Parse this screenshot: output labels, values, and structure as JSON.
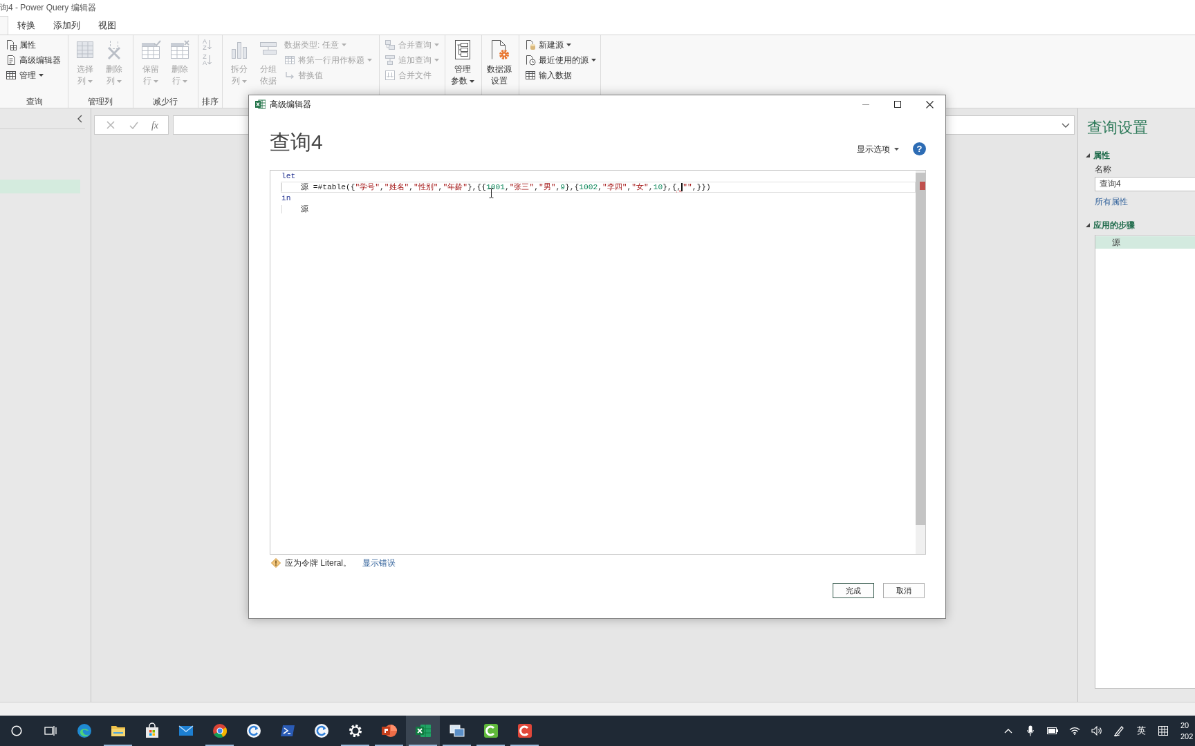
{
  "window": {
    "title": "询4 - Power Query 编辑器"
  },
  "ribbon": {
    "tabs": [
      {
        "label": "转换",
        "selected": false
      },
      {
        "label": "添加列",
        "selected": false
      },
      {
        "label": "视图",
        "selected": false
      }
    ],
    "groups": [
      {
        "label": "查询",
        "items": [
          {
            "kind": "small",
            "label": "属性",
            "disabled": false,
            "dropdown": false
          },
          {
            "kind": "small",
            "label": "高级编辑器",
            "disabled": false,
            "dropdown": false
          },
          {
            "kind": "small",
            "label": "管理",
            "disabled": false,
            "dropdown": true
          }
        ]
      },
      {
        "label": "管理列",
        "items": [
          {
            "kind": "large",
            "lines": [
              "选择",
              "列"
            ],
            "disabled": true,
            "dropdown": true
          },
          {
            "kind": "large",
            "lines": [
              "删除",
              "列"
            ],
            "disabled": true,
            "dropdown": true
          }
        ]
      },
      {
        "label": "减少行",
        "items": [
          {
            "kind": "large",
            "lines": [
              "保留",
              "行"
            ],
            "disabled": true,
            "dropdown": true
          },
          {
            "kind": "large",
            "lines": [
              "删除",
              "行"
            ],
            "disabled": true,
            "dropdown": true
          }
        ]
      },
      {
        "label": "排序",
        "items": [
          {
            "kind": "sort",
            "letters": [
              "A",
              "Z"
            ],
            "disabled": true
          },
          {
            "kind": "sort",
            "letters": [
              "Z",
              "A"
            ],
            "disabled": true
          }
        ]
      },
      {
        "items": [
          {
            "kind": "large",
            "lines": [
              "拆分",
              "列"
            ],
            "disabled": true,
            "dropdown": true
          },
          {
            "kind": "large",
            "lines": [
              "分组",
              "依据"
            ],
            "disabled": true,
            "dropdown": false
          },
          {
            "kind": "small",
            "label": "数据类型: 任意",
            "disabled": true,
            "dropdown": true
          },
          {
            "kind": "small",
            "label": "将第一行用作标题",
            "disabled": true,
            "dropdown": true
          },
          {
            "kind": "small",
            "label": "替换值",
            "disabled": true,
            "dropdown": false
          }
        ]
      },
      {
        "items": [
          {
            "kind": "small",
            "label": "合并查询",
            "disabled": true,
            "dropdown": true
          },
          {
            "kind": "small",
            "label": "追加查询",
            "disabled": true,
            "dropdown": true
          },
          {
            "kind": "small",
            "label": "合并文件",
            "disabled": true,
            "dropdown": false
          }
        ]
      },
      {
        "items": [
          {
            "kind": "large",
            "lines": [
              "管理",
              "参数"
            ],
            "disabled": false,
            "dropdown": true
          }
        ]
      },
      {
        "items": [
          {
            "kind": "large",
            "lines": [
              "数据源",
              "设置"
            ],
            "disabled": false,
            "dropdown": false
          }
        ]
      },
      {
        "items": [
          {
            "kind": "small",
            "label": "新建源",
            "disabled": false,
            "dropdown": true
          },
          {
            "kind": "small",
            "label": "最近使用的源",
            "disabled": false,
            "dropdown": true
          },
          {
            "kind": "small",
            "label": "输入数据",
            "disabled": false,
            "dropdown": false
          }
        ]
      }
    ]
  },
  "queries_pane": {
    "rows": [
      {
        "selected": true
      }
    ]
  },
  "formula_bar": {
    "fx_label": "fx"
  },
  "query_settings": {
    "title": "查询设置",
    "properties": {
      "heading": "属性",
      "expanded": true,
      "name_label": "名称",
      "name_value": "查询4",
      "all_properties_link": "所有属性"
    },
    "applied_steps": {
      "heading": "应用的步骤",
      "expanded": true,
      "steps": [
        {
          "label": "源",
          "selected": true
        }
      ]
    }
  },
  "dialog": {
    "title": "高级编辑器",
    "heading": "查询4",
    "display_options": {
      "label": "显示选项",
      "dropdown": true
    },
    "help_label": "?",
    "editor": {
      "lines": [
        {
          "current": false,
          "tokens": [
            {
              "kind": "keyword",
              "text": "let"
            }
          ]
        },
        {
          "current": true,
          "tokens": [
            {
              "kind": "plain",
              "text": "    源 =#table({"
            },
            {
              "kind": "string",
              "text": "\"学号\""
            },
            {
              "kind": "plain",
              "text": ","
            },
            {
              "kind": "string",
              "text": "\"姓名\""
            },
            {
              "kind": "plain",
              "text": ","
            },
            {
              "kind": "string",
              "text": "\"性别\""
            },
            {
              "kind": "plain",
              "text": ","
            },
            {
              "kind": "string",
              "text": "\"年龄\""
            },
            {
              "kind": "plain",
              "text": "},{{"
            },
            {
              "kind": "number",
              "text": "1001"
            },
            {
              "kind": "plain",
              "text": ","
            },
            {
              "kind": "string",
              "text": "\"张三\""
            },
            {
              "kind": "plain",
              "text": ","
            },
            {
              "kind": "string",
              "text": "\"男\""
            },
            {
              "kind": "plain",
              "text": ","
            },
            {
              "kind": "number",
              "text": "9"
            },
            {
              "kind": "plain",
              "text": "},{"
            },
            {
              "kind": "number",
              "text": "1002"
            },
            {
              "kind": "plain",
              "text": ","
            },
            {
              "kind": "string",
              "text": "\"李四\""
            },
            {
              "kind": "plain",
              "text": ","
            },
            {
              "kind": "string",
              "text": "\"女\""
            },
            {
              "kind": "plain",
              "text": ","
            },
            {
              "kind": "number",
              "text": "10"
            },
            {
              "kind": "plain",
              "text": "},{"
            },
            {
              "kind": "error",
              "text": ",",
              "caret_after": true
            },
            {
              "kind": "string",
              "text": "\"\""
            },
            {
              "kind": "plain",
              "text": ",}})"
            }
          ]
        },
        {
          "current": false,
          "tokens": [
            {
              "kind": "keyword",
              "text": "in"
            }
          ]
        },
        {
          "current": false,
          "tokens": [
            {
              "kind": "plain",
              "text": "    源"
            }
          ]
        }
      ]
    },
    "error": {
      "message": "应为令牌 Literal。",
      "link": "显示错误"
    },
    "buttons": [
      {
        "label": "完成",
        "default": true
      },
      {
        "label": "取消",
        "default": false
      }
    ]
  },
  "taskbar": {
    "apps": [
      {
        "running": false,
        "selected": false
      },
      {
        "running": true,
        "selected": false
      },
      {
        "running": false,
        "selected": false
      },
      {
        "running": false,
        "selected": false
      },
      {
        "running": true,
        "selected": false
      },
      {
        "running": false,
        "selected": false
      },
      {
        "running": false,
        "selected": false
      },
      {
        "running": false,
        "selected": false
      },
      {
        "running": true,
        "selected": false
      },
      {
        "running": true,
        "selected": false
      },
      {
        "running": true,
        "selected": true
      },
      {
        "running": true,
        "selected": false
      },
      {
        "running": true,
        "selected": false
      },
      {
        "running": true,
        "selected": false
      }
    ],
    "input_method": "英",
    "clock": [
      "20",
      "202"
    ]
  }
}
